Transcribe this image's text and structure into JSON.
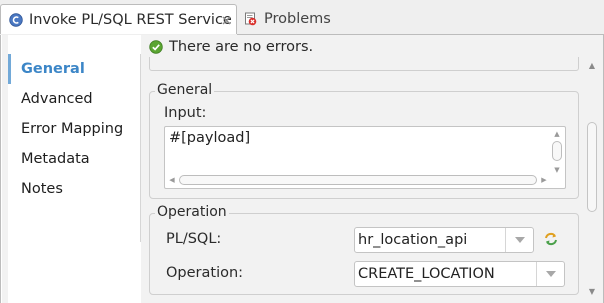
{
  "tabs": [
    {
      "label": "Invoke PL/SQL REST Service",
      "icon": "component-icon",
      "active": true
    },
    {
      "label": "Problems",
      "icon": "problems-icon",
      "active": false
    }
  ],
  "sidebar": {
    "items": [
      {
        "label": "General",
        "active": true
      },
      {
        "label": "Advanced"
      },
      {
        "label": "Error Mapping"
      },
      {
        "label": "Metadata"
      },
      {
        "label": "Notes"
      }
    ]
  },
  "status": {
    "text": "There are no errors.",
    "icon": "check-circle-icon"
  },
  "general": {
    "title": "General",
    "input_label": "Input:",
    "input_value": "#[payload]"
  },
  "operation": {
    "title": "Operation",
    "plsql_label": "PL/SQL:",
    "plsql_value": "hr_location_api",
    "operation_label": "Operation:",
    "operation_value": "CREATE_LOCATION"
  },
  "colors": {
    "accent": "#3c86c7",
    "status_ok": "#5aa531"
  }
}
